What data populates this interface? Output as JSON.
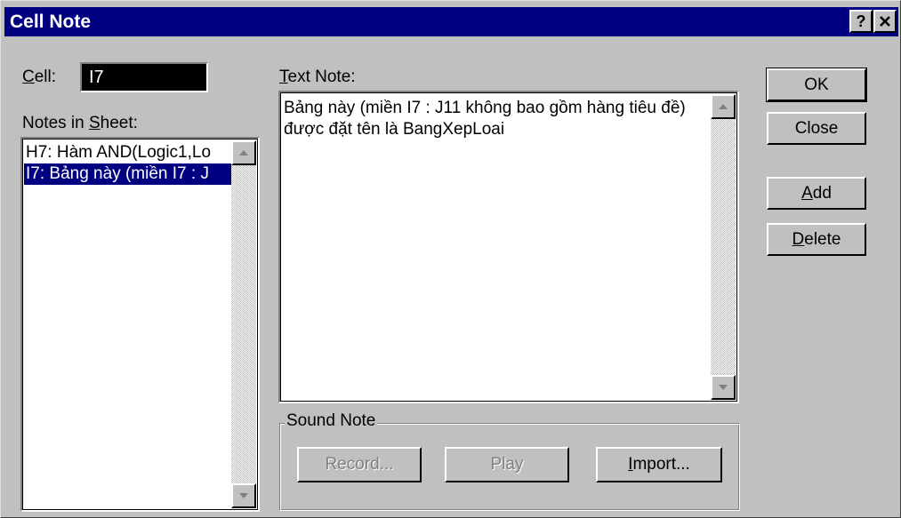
{
  "window": {
    "title": "Cell Note",
    "help_button": "?",
    "close_button": "✕"
  },
  "cell": {
    "label_prefix": "",
    "label_accel": "C",
    "label_rest": "ell:",
    "value": "I7"
  },
  "notes_in_sheet": {
    "label_prefix": "Notes in ",
    "label_accel": "S",
    "label_rest": "heet:",
    "items": [
      {
        "text": "H7: Hàm AND(Logic1,Lo",
        "selected": false
      },
      {
        "text": "I7: Bảng này (miền I7 : J",
        "selected": true
      }
    ]
  },
  "text_note": {
    "label_prefix": "",
    "label_accel": "T",
    "label_rest": "ext Note:",
    "value": "Bảng này (miền I7 : J11 không bao gồm hàng tiêu đề) được đặt tên là BangXepLoai"
  },
  "sound_note": {
    "label": "Sound Note",
    "record_label": "Record...",
    "play_label": "Play",
    "import_prefix": "",
    "import_accel": "I",
    "import_rest": "mport..."
  },
  "buttons": {
    "ok_label": "OK",
    "close_label": "Close",
    "add_prefix": "",
    "add_accel": "A",
    "add_rest": "dd",
    "delete_prefix": "",
    "delete_accel": "D",
    "delete_rest": "elete"
  },
  "colors": {
    "titlebar": "#000080",
    "dialog_face": "#c0c0c0",
    "selection": "#000080"
  }
}
